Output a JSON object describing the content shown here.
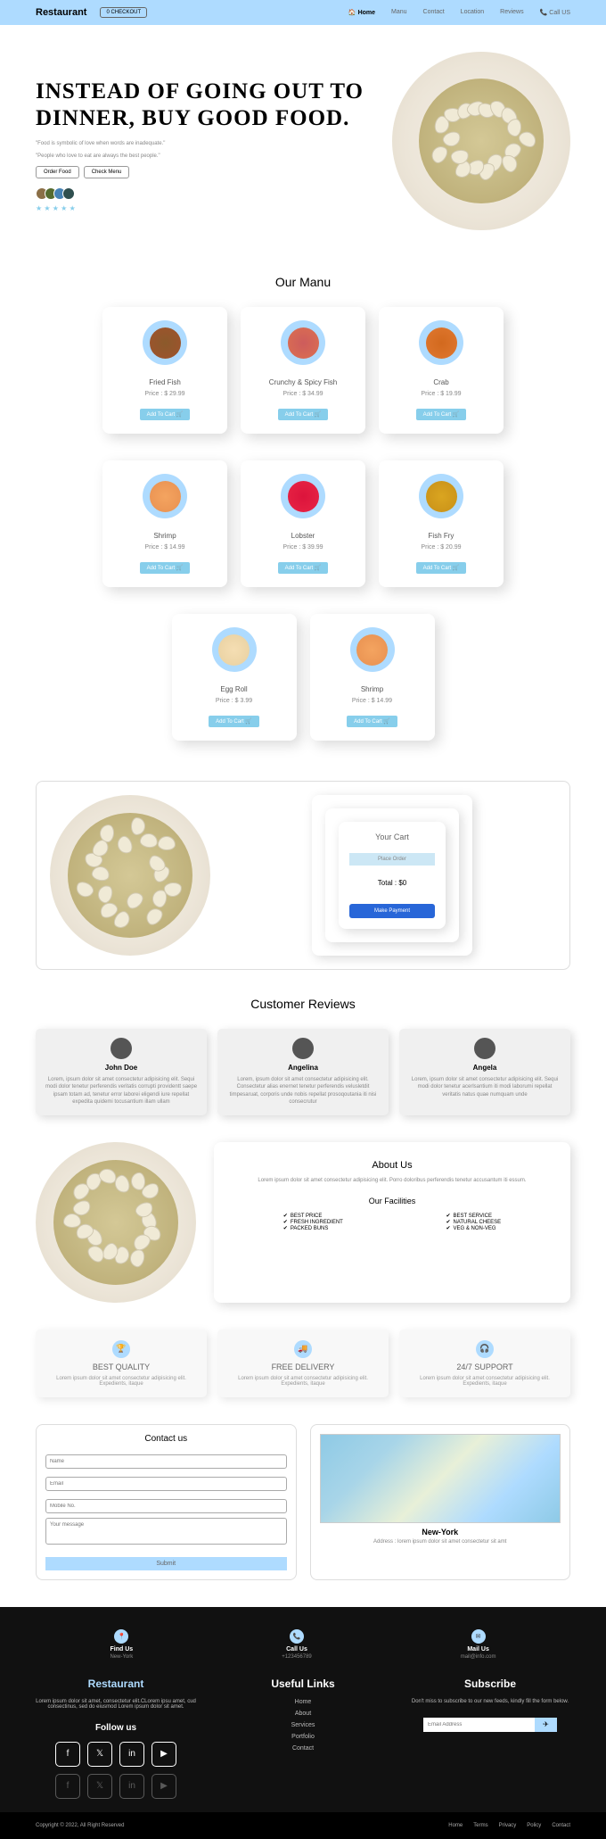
{
  "nav": {
    "brand": "Restaurant",
    "checkout": "0 CHECKOUT",
    "links": [
      "Home",
      "Manu",
      "Contact",
      "Location",
      "Reviews",
      "Call US"
    ]
  },
  "hero": {
    "title": "INSTEAD OF GOING OUT TO DINNER, BUY GOOD FOOD.",
    "subtitle1": "\"Food is symbolic of love when words are inadequate.\"",
    "subtitle2": "\"People who love to eat are always the best people.\"",
    "btn1": "Order Food",
    "btn2": "Check Menu"
  },
  "menu": {
    "title": "Our Manu",
    "items": [
      {
        "name": "Fried Fish",
        "price": "Price : $ 29.99",
        "color1": "#8b5a2b",
        "color2": "#a0522d"
      },
      {
        "name": "Crunchy & Spicy Fish",
        "price": "Price : $ 34.99",
        "color1": "#cd5c5c",
        "color2": "#dc7050"
      },
      {
        "name": "Crab",
        "price": "Price : $ 19.99",
        "color1": "#d2691e",
        "color2": "#e07830"
      },
      {
        "name": "Shrimp",
        "price": "Price : $ 14.99",
        "color1": "#f4a460",
        "color2": "#e89050"
      },
      {
        "name": "Lobster",
        "price": "Price : $ 39.99",
        "color1": "#dc143c",
        "color2": "#e82545"
      },
      {
        "name": "Fish Fry",
        "price": "Price : $ 20.99",
        "color1": "#daa520",
        "color2": "#c89018"
      },
      {
        "name": "Egg Roll",
        "price": "Price : $ 3.99",
        "color1": "#f5deb3",
        "color2": "#e8d0a0"
      },
      {
        "name": "Shrimp",
        "price": "Price : $ 14.99",
        "color1": "#f4a460",
        "color2": "#e89050"
      }
    ],
    "addBtn": "Add To Cart 🛒"
  },
  "cart": {
    "title": "Your Cart",
    "placeOrder": "Place Order",
    "total": "Total : $0",
    "payment": "Make Payment"
  },
  "reviews": {
    "title": "Customer Reviews",
    "items": [
      {
        "name": "John Doe",
        "text": "Lorem, ipsum dolor sit amet consectetur adipisicing elit. Sequi modi dolor tenetur perferendis veritatis corrupti providentt saepe ipsam totam ad, tenetur error laborei eligendi iure repellat expedita quidemi tocusantium illam ullam"
      },
      {
        "name": "Angelina",
        "text": "Lorem, ipsum dolor sit amet consectetur adipisicing elit. Consectetur alias enernet tenetur perferendis velusletdit timpesaruat, corporis unde nobis repellat prosoqoutania iti nisi consecrutur"
      },
      {
        "name": "Angela",
        "text": "Lorem, ipsum dolor sit amet consectetur adipisicing elit. Sequi modi dolor tenetur acerlsantium iti modi laborumi repellat veritatis natus quae numquam unde"
      }
    ]
  },
  "about": {
    "title": "About Us",
    "text": "Lorem ipsum dolor sit amet consectetur adipisicing elit. Porro doloribus perferendis tenetur accusantum iti essum.",
    "facilitiesTitle": "Our Facilities",
    "col1": [
      "BEST PRICE",
      "FRESH INGREDIENT",
      "PACKED BUNS"
    ],
    "col2": [
      "BEST SERVICE",
      "NATURAL CHEESE",
      "VEG & NON-VEG"
    ]
  },
  "features": [
    {
      "icon": "🏆",
      "title": "BEST QUALITY",
      "text": "Lorem ipsum dolor sit amet consectetur adipisicing elit. Expedients, itaque"
    },
    {
      "icon": "🚚",
      "title": "FREE DELIVERY",
      "text": "Lorem ipsum dolor sit amet consectetur adipisicing elit. Expedients, itaque"
    },
    {
      "icon": "🎧",
      "title": "24/7 SUPPORT",
      "text": "Lorem ipsum dolor sit amet consectetur adipisicing elit. Expedients, itaque"
    }
  ],
  "contact": {
    "title": "Contact us",
    "fields": [
      "Name",
      "Email",
      "Mobile No.",
      "Your message"
    ],
    "submit": "Submit",
    "city": "New-York",
    "address": "Address : lorem ipsum dolor sit amet consectetur sit amt"
  },
  "footer": {
    "find": {
      "title": "Find Us",
      "text": "New-York"
    },
    "call": {
      "title": "Call Us",
      "text": "+123456789"
    },
    "mail": {
      "title": "Mail Us",
      "text": "mail@info.com"
    },
    "brand": "Restaurant",
    "brandText": "Lorem ipsum dolor sit amet, consectetur elit.CLorem ipsu amet, cud consectinus, sed do eiusmod Lorem ipsum dolor sit amet.",
    "follow": "Follow us",
    "linksTitle": "Useful Links",
    "links": [
      "Home",
      "About",
      "Services",
      "Portfolio",
      "Contact"
    ],
    "subTitle": "Subscribe",
    "subText": "Don't miss to subscribe to our new feeds, kindly fill the form below.",
    "subPlaceholder": "Email Address",
    "copyright": "Copyright © 2022, All Right Reserved",
    "bottomLinks": [
      "Home",
      "Terms",
      "Privacy",
      "Policy",
      "Contact"
    ]
  }
}
